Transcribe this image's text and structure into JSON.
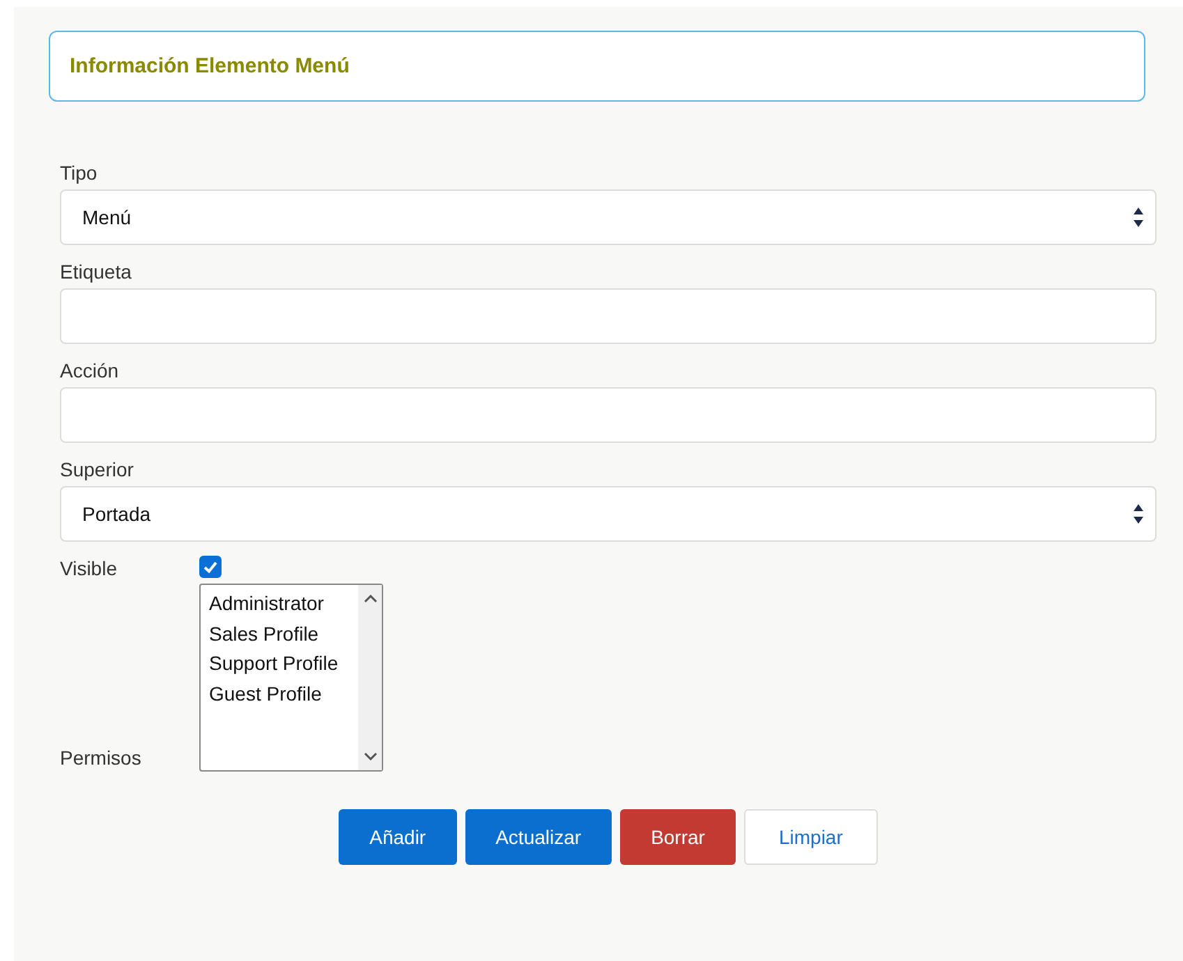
{
  "header": {
    "title": "Información Elemento Menú"
  },
  "fields": [
    {
      "kind": "select",
      "label": "Tipo",
      "value": "Menú"
    },
    {
      "kind": "text",
      "label": "Etiqueta"
    },
    {
      "kind": "text",
      "label": "Acción"
    },
    {
      "kind": "select",
      "label": "Superior",
      "value": "Portada"
    }
  ],
  "visible": {
    "label": "Visible",
    "checked": true
  },
  "permissions": {
    "label": "Permisos",
    "options": [
      {
        "label": "Administrator",
        "selected": false
      },
      {
        "label": "Sales Profile",
        "selected": false
      },
      {
        "label": "Support Profile",
        "selected": false
      },
      {
        "label": "Guest Profile",
        "selected": false
      }
    ]
  },
  "buttons": [
    {
      "label": "Añadir",
      "kind": "primary"
    },
    {
      "label": "Actualizar",
      "kind": "primary"
    },
    {
      "label": "Borrar",
      "kind": "danger"
    },
    {
      "label": "Limpiar",
      "kind": "default"
    }
  ]
}
